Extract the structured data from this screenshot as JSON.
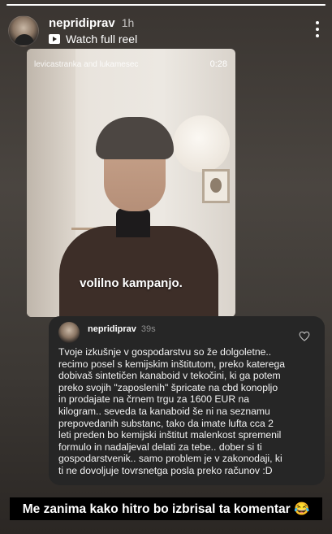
{
  "story": {
    "progress": 1.0
  },
  "header": {
    "username": "nepridiprav",
    "time": "1h",
    "reel_link": "Watch full reel"
  },
  "video": {
    "author": "levicastranka and lukamesec",
    "duration": "0:28",
    "caption": "volilno kampanjo."
  },
  "comment": {
    "username": "nepridiprav",
    "time": "39s",
    "text": "Tvoje izkušnje v gospodarstvu so že dolgoletne.. recimo posel s kemijskim inštitutom, preko katerega dobivaš sintetičen kanaboid v tekočini, ki ga potem preko svojih \"zaposlenih\" špricate na cbd konopljo in prodajate na črnem trgu za 1600 EUR na kilogram.. seveda ta kanaboid še ni na seznamu prepovedanih substanc, tako da imate lufta cca 2 leti preden bo kemijski inštitut malenkost spremenil formulo in nadaljeval delati za tebe.. dober si ti gospodarstvenik.. samo problem je v zakonodaji, ki ti ne dovoljuje tovrsnetga posla preko računov :D"
  },
  "banner": {
    "text": "Me zanima kako hitro bo izbrisal ta komentar 😂"
  },
  "icons": {
    "reel": "play-icon",
    "more": "more-icon",
    "like": "heart-icon"
  }
}
